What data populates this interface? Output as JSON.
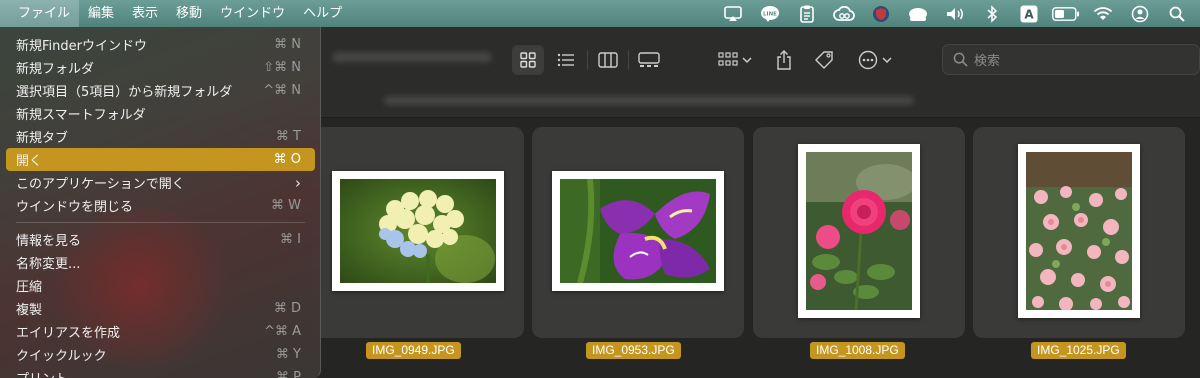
{
  "menubar": {
    "items": [
      "ファイル",
      "編集",
      "表示",
      "移動",
      "ウインドウ",
      "ヘルプ"
    ],
    "line_icon_text": "LINE",
    "input_mode": "A"
  },
  "search": {
    "placeholder": "検索"
  },
  "file_menu": {
    "items": [
      {
        "label": "新規Finderウインドウ",
        "shortcut": "⌘ N"
      },
      {
        "label": "新規フォルダ",
        "shortcut": "⇧⌘ N"
      },
      {
        "label": "選択項目（5項目）から新規フォルダ",
        "shortcut": "^⌘ N"
      },
      {
        "label": "新規スマートフォルダ",
        "shortcut": ""
      },
      {
        "label": "新規タブ",
        "shortcut": "⌘ T"
      },
      {
        "label": "開く",
        "shortcut": "⌘ O"
      },
      {
        "label": "このアプリケーションで開く",
        "shortcut": "›"
      },
      {
        "label": "ウインドウを閉じる",
        "shortcut": "⌘ W"
      },
      {
        "label": "情報を見る",
        "shortcut": "⌘ I"
      },
      {
        "label": "名称変更...",
        "shortcut": ""
      },
      {
        "label": "圧縮",
        "shortcut": ""
      },
      {
        "label": "複製",
        "shortcut": "⌘ D"
      },
      {
        "label": "エイリアスを作成",
        "shortcut": "^⌘ A"
      },
      {
        "label": "クイックルック",
        "shortcut": "⌘ Y"
      },
      {
        "label": "プリント",
        "shortcut": "⌘ P"
      }
    ]
  },
  "files": [
    {
      "name": "IMG_0949.JPG"
    },
    {
      "name": "IMG_0953.JPG"
    },
    {
      "name": "IMG_1008.JPG"
    },
    {
      "name": "IMG_1025.JPG"
    }
  ],
  "colors": {
    "accent": "#c4961f",
    "menubar": "#5f928b"
  }
}
